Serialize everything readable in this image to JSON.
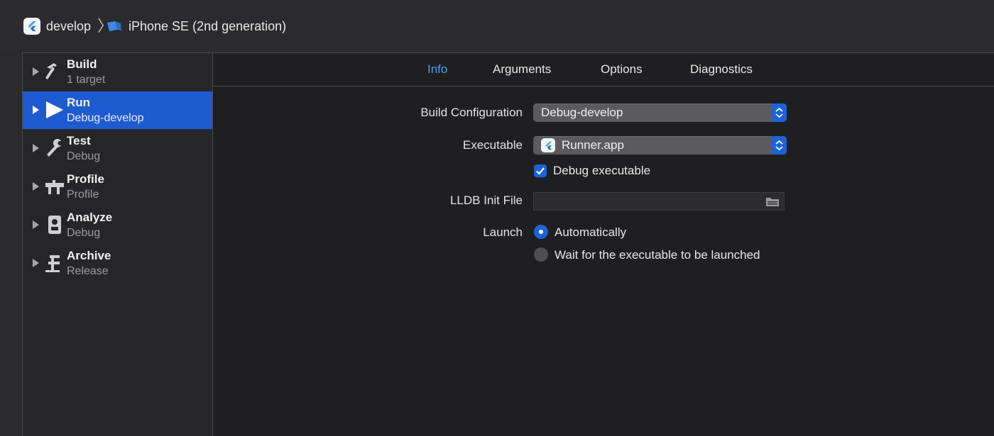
{
  "breadcrumb": {
    "scheme": "develop",
    "separator": "〉",
    "device": "iPhone SE (2nd generation)"
  },
  "sidebar": {
    "items": [
      {
        "title": "Build",
        "subtitle": "1 target",
        "icon": "hammer-icon"
      },
      {
        "title": "Run",
        "subtitle": "Debug-develop",
        "icon": "play-icon"
      },
      {
        "title": "Test",
        "subtitle": "Debug",
        "icon": "wrench-icon"
      },
      {
        "title": "Profile",
        "subtitle": "Profile",
        "icon": "instruments-icon"
      },
      {
        "title": "Analyze",
        "subtitle": "Debug",
        "icon": "analyze-icon"
      },
      {
        "title": "Archive",
        "subtitle": "Release",
        "icon": "archive-icon"
      }
    ]
  },
  "tabs": [
    "Info",
    "Arguments",
    "Options",
    "Diagnostics"
  ],
  "form": {
    "build_configuration_label": "Build Configuration",
    "build_configuration_value": "Debug-develop",
    "executable_label": "Executable",
    "executable_value": "Runner.app",
    "debug_executable_label": "Debug executable",
    "debug_executable_checked": true,
    "lldb_init_label": "LLDB Init File",
    "lldb_init_value": "",
    "launch_label": "Launch",
    "launch_options": [
      "Automatically",
      "Wait for the executable to be launched"
    ],
    "launch_selected": "Automatically"
  },
  "colors": {
    "accent": "#1e63d6",
    "selection": "#1e5bd0",
    "active_tab": "#4a9ef5",
    "background": "#1f1f21"
  }
}
